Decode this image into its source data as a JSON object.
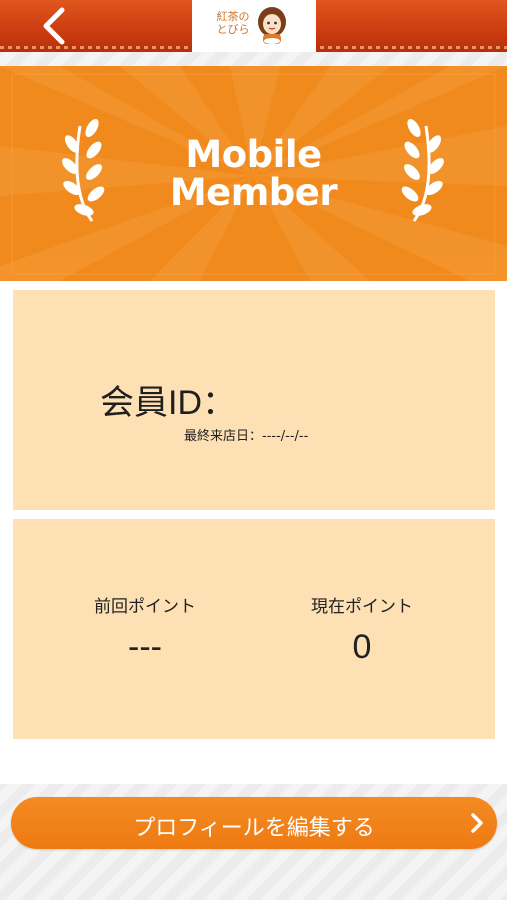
{
  "header": {
    "logo_text": "紅茶の\nとびら",
    "back_icon": "chevron-left-icon"
  },
  "banner": {
    "title_line1": "Mobile",
    "title_line2": "Member",
    "laurel_icon": "laurel-icon"
  },
  "member_card": {
    "id_label": "会員ID：",
    "last_visit": "最終来店日：----/--/--"
  },
  "points_card": {
    "previous_label": "前回ポイント",
    "previous_value": "---",
    "current_label": "現在ポイント",
    "current_value": "0"
  },
  "edit_profile": {
    "label": "プロフィールを編集する",
    "chevron_icon": "chevron-right-icon"
  },
  "colors": {
    "accent": "#f18a1d",
    "header": "#c8380f",
    "card": "#fde0b3"
  }
}
